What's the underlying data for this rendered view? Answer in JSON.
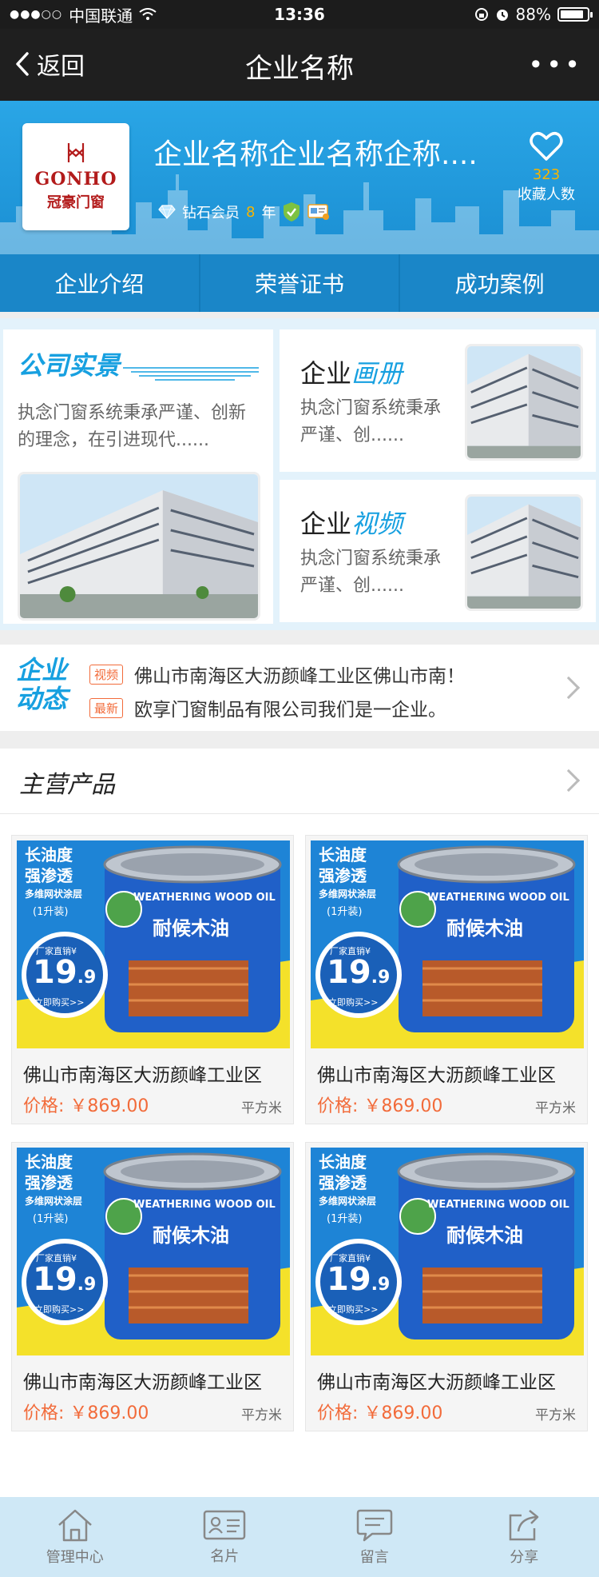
{
  "status_bar": {
    "carrier": "中国联通",
    "time": "13:36",
    "battery": "88%",
    "battery_level": 0.88
  },
  "nav": {
    "back_label": "返回",
    "title": "企业名称",
    "more": "•••"
  },
  "company": {
    "name": "企业名称企业名称企称....",
    "logo_en": "GONHO",
    "logo_cn": "冠豪门窗",
    "member_level": "钻石会员",
    "years": "8",
    "years_suffix": "年",
    "fav_count": "323",
    "fav_label": "收藏人数"
  },
  "tabs": [
    {
      "label": "企业介绍"
    },
    {
      "label": "荣誉证书"
    },
    {
      "label": "成功案例"
    }
  ],
  "gallery": {
    "main": {
      "title": "公司实景",
      "desc": "执念门窗系统秉承严谨、创新的理念，在引进现代......"
    },
    "album": {
      "title_prefix": "企业",
      "title_highlight": "画册",
      "desc": "执念门窗系统秉承严谨、创......"
    },
    "video": {
      "title_prefix": "企业",
      "title_highlight": "视频",
      "desc": "执念门窗系统秉承严谨、创......"
    }
  },
  "news": {
    "title_line1": "企业",
    "title_line2": "动态",
    "items": [
      {
        "tag": "视频",
        "text": "佛山市南海区大沥颜峰工业区佛山市南！"
      },
      {
        "tag": "最新",
        "text": "欧享门窗制品有限公司我们是一企业。"
      }
    ]
  },
  "products": {
    "title": "主营产品",
    "items": [
      {
        "name": "佛山市南海区大沥颜峰工业区",
        "price": "价格: ￥869.00",
        "unit": "平方米"
      },
      {
        "name": "佛山市南海区大沥颜峰工业区",
        "price": "价格: ￥869.00",
        "unit": "平方米"
      },
      {
        "name": "佛山市南海区大沥颜峰工业区",
        "price": "价格: ￥869.00",
        "unit": "平方米"
      },
      {
        "name": "佛山市南海区大沥颜峰工业区",
        "price": "价格: ￥869.00",
        "unit": "平方米"
      }
    ],
    "ad": {
      "line1": "长油度",
      "line2": "强渗透",
      "line3": "多维网状涂层",
      "line4": "(1升装)",
      "promo": "厂家直销¥",
      "price_big": "19",
      "price_small": ".9",
      "buy": "立即购买>>",
      "can_en": "WEATHERING WOOD OIL",
      "can_cn": "耐候木油"
    }
  },
  "toolbar": [
    {
      "label": "管理中心",
      "icon": "home-icon"
    },
    {
      "label": "名片",
      "icon": "card-icon"
    },
    {
      "label": "留言",
      "icon": "message-icon"
    },
    {
      "label": "分享",
      "icon": "share-icon"
    }
  ],
  "colors": {
    "accent": "#17a0e0",
    "price": "#f26b3a",
    "nav_bg": "#1f1f1f",
    "tab_bg": "#1a86c8"
  }
}
